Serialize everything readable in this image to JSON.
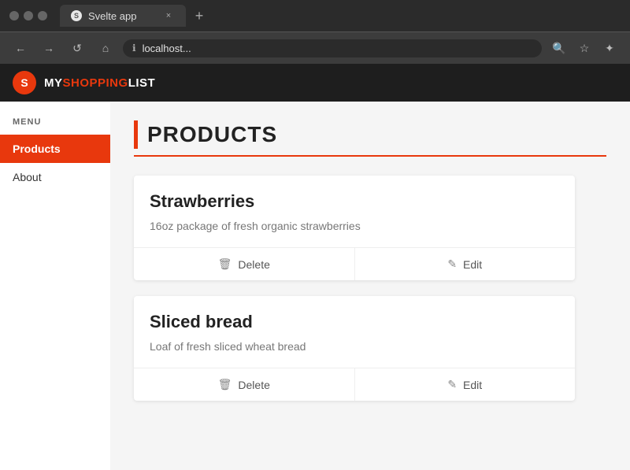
{
  "browser": {
    "traffic_lights": [
      "close",
      "minimize",
      "maximize"
    ],
    "tab": {
      "favicon": "S",
      "title": "Svelte app",
      "close_icon": "×"
    },
    "new_tab_icon": "+",
    "toolbar": {
      "back_icon": "←",
      "forward_icon": "→",
      "reload_icon": "↺",
      "home_icon": "⌂",
      "info_icon": "ℹ",
      "address": "localhost...",
      "zoom_icon": "🔍",
      "star_icon": "☆",
      "collection_icon": "☆"
    }
  },
  "app": {
    "logo_letter": "S",
    "title_my": "MY",
    "title_shopping": "SHOPPING",
    "title_list": "LIST"
  },
  "sidebar": {
    "menu_label": "MENU",
    "items": [
      {
        "id": "products",
        "label": "Products",
        "active": true
      },
      {
        "id": "about",
        "label": "About",
        "active": false
      }
    ]
  },
  "main": {
    "page_title": "PRODUCTS",
    "products": [
      {
        "id": 1,
        "name": "Strawberries",
        "description": "16oz package of fresh organic strawberries",
        "delete_label": "Delete",
        "edit_label": "Edit"
      },
      {
        "id": 2,
        "name": "Sliced bread",
        "description": "Loaf of fresh sliced wheat bread",
        "delete_label": "Delete",
        "edit_label": "Edit"
      }
    ]
  }
}
